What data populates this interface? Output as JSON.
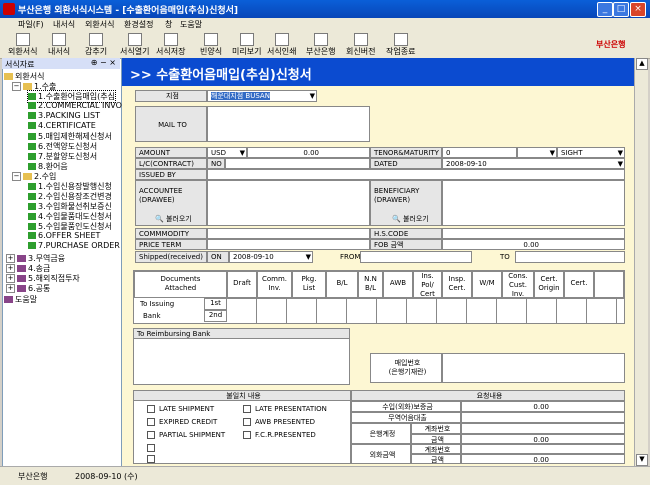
{
  "window": {
    "title": "부산은행 외환서식시스템 - [수출환어음매입(추심)신청서]",
    "min": "_",
    "max": "□",
    "close": "×"
  },
  "menu": [
    "파일(F)",
    "내서식",
    "외환서식",
    "환경설정",
    "창",
    "도움말"
  ],
  "toolbar": [
    "외환서식",
    "내서식",
    "감추기",
    "서식열기",
    "서식저장",
    "빈양식",
    "미리보기",
    "서식인쇄",
    "부산은행",
    "회신버전",
    "작업종료"
  ],
  "brand": "부산은행",
  "tree": {
    "header": "서식자료",
    "root": "외환서식",
    "g1": "1.수출",
    "g1items": [
      "1.수출환어음매입(추심",
      "2.COMMERCIAL INVOICE",
      "3.PACKING LIST",
      "4.CERTIFICATE",
      "5.매입제한해제신청서",
      "6.전액양도신청서",
      "7.분할양도신청서",
      "8.환어음"
    ],
    "g2": "2.수입",
    "g2items": [
      "1.수입신용장발행신청",
      "2.수입신용장조건변경",
      "3.수입화물선취보증신",
      "4.수입물품대도신청서",
      "5.수입물품인도신청서",
      "6.OFFER SHEET",
      "7.PURCHASE ORDER"
    ],
    "others": [
      "3.무역금융",
      "4.송금",
      "5.해외직접투자",
      "6.공통"
    ],
    "help": "도움말"
  },
  "form": {
    "title": ">>  수출환어음매입(추심)신청서",
    "branch_label": "지점",
    "branch_value": "해운대지점 BUSAN",
    "mailto": "MAIL TO",
    "amount": "AMOUNT",
    "currency": "USD",
    "amount_value": "0.00",
    "tenor": "TENOR&MATURITY",
    "tenor_value": "0",
    "sight": "SIGHT",
    "lc": "L/C(CONTRACT)",
    "no": "NO",
    "dated": "DATED",
    "dated_value": "2008-09-10",
    "issued": "ISSUED BY",
    "accountee": "ACCOUNTEE\n(DRAWEE)",
    "beneficiary": "BENEFICIARY\n(DRAWER)",
    "load": "불러오기",
    "commodity": "COMMMODITY",
    "hscode": "H.S.CODE",
    "price": "PRICE TERM",
    "fob": "FOB 금액",
    "fob_value": "0.00",
    "shipped": "Shipped(received)",
    "on": "ON",
    "ship_date": "2008-09-10",
    "from": "FROM",
    "to": "TO",
    "doc_head": "Documents\nAttached",
    "doc_cols": [
      "Draft",
      "Comm.\nInv.",
      "Pkg.\nList",
      "B/L",
      "N.N\nB/L",
      "AWB",
      "Ins.\nPol/\nCert",
      "Insp.\nCert.",
      "W/M",
      "Cons.\nCust.\nInv.",
      "Cert.\nOrigin",
      "Cert."
    ],
    "to_issuing": "To Issuing",
    "bank": "Bank",
    "first": "1st",
    "second": "2nd",
    "reimb": "To Reimbursing Bank",
    "buyer_no": "매입번호\n(은행기재란)",
    "defects_title": "불일치 내용",
    "defects": [
      "LATE SHIPMENT",
      "LATE PRESENTATION",
      "EXPIRED CREDIT",
      "AWB PRESENTED",
      "PARTIAL SHIPMENT",
      "F.C.R.PRESENTED"
    ],
    "req_title": "요청내용",
    "req": {
      "fx_amt": "수입(외화)보증금",
      "fx_value": "0.00",
      "trade": "무역어음대출",
      "bank_acct": "은행계정",
      "acct_no": "계좌번호",
      "amt": "금액",
      "amt_value": "0.00",
      "fx_acct": "외화금액",
      "fx_acct_no": "계좌번호",
      "fx_amt2": "금액",
      "fx_amt2_value": "0.00"
    }
  },
  "status": {
    "left": "부산은행",
    "date": "2008-09-10 (수)"
  }
}
